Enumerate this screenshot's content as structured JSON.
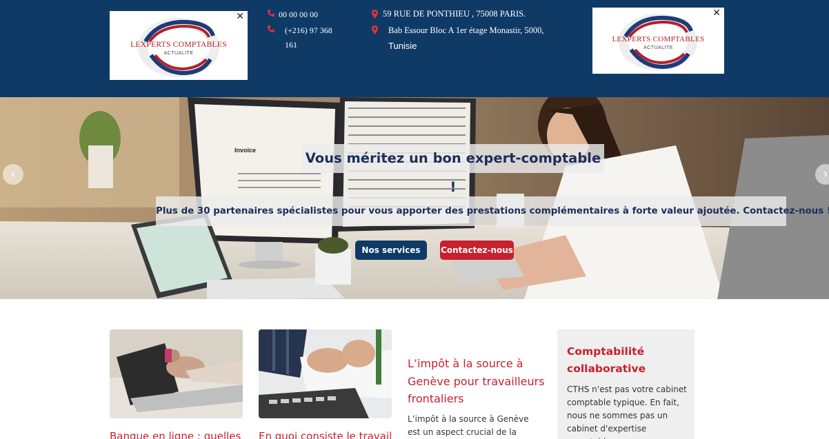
{
  "header": {
    "logo_text": "LEXPERTS COMPTABLES",
    "logo_subtext": "ACTUALITE",
    "close_glyph": "✕",
    "phone_1": "00 00 00 00",
    "phone_2_line1": "(+216) 97 368",
    "phone_2_line2": "161",
    "address_paris": "59 RUE DE PONTHIEU , 75008 PARIS.",
    "address_tunisia_line1": "Bab Essour Bloc A 1er étage Monastir, 5000,",
    "address_tunisia_line2": "Tunisie",
    "icons": {
      "phone": "phone-icon",
      "location": "location-pin-icon"
    },
    "colors": {
      "background": "#0f3a66",
      "icon_accent": "#e0303a"
    }
  },
  "hero": {
    "title": "Vous méritez un bon expert-comptable !",
    "subtitle": "Plus de 30 partenaires spécialistes pour vous apporter des prestations complémentaires à forte valeur ajoutée. Contactez-nous !",
    "button_services": "Nos services",
    "button_contact": "Contactez-nous",
    "prev_arrow": "‹",
    "next_arrow": "›",
    "screen_label": "Invoice",
    "colors": {
      "primary": "#0f3a66",
      "accent": "#c8202e",
      "text": "#1b2e5a"
    }
  },
  "content": {
    "card1_title": "Banque en ligne : quelles",
    "card2_title": "En quoi consiste le travail",
    "article": {
      "title": "L’impôt à la source à Genève pour travailleurs frontaliers",
      "text": "L’impôt à la source à Genève est un aspect crucial de la fiscalité"
    },
    "sidebox": {
      "title": "Comptabilité collaborative",
      "text": "CTHS n'est pas votre cabinet comptable typique. En fait, nous ne sommes pas un cabinet d'expertise comptable ou nous ne"
    }
  }
}
